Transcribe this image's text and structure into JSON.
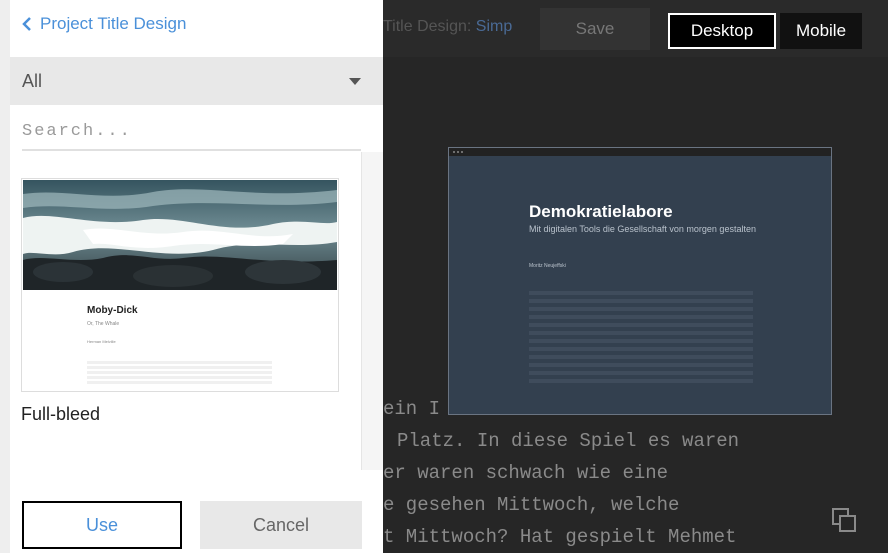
{
  "editor": {
    "title_prefix": "Title Design:",
    "title_highlight": "Simp",
    "save_label": "Save",
    "desktop_label": "Desktop",
    "mobile_label": "Mobile",
    "body_lines": [
      "ein I",
      "Platz. In diese Spiel es waren",
      "er waren schwach wie eine",
      "e gesehen Mittwoch, welche",
      "t Mittwoch? Hat gespielt Mehmet"
    ]
  },
  "preview": {
    "title": "Demokratielabore",
    "subtitle": "Mit digitalen Tools die Gesellschaft von morgen gestalten",
    "author": "Moritz Neujeffski"
  },
  "panel": {
    "back_label": "Project Title Design",
    "category": "All",
    "search_placeholder": "Search...",
    "templates": [
      {
        "thumb_title": "Moby-Dick",
        "thumb_subtitle": "Or, The Whale",
        "thumb_author": "Herman Melville",
        "name": "Full-bleed"
      }
    ],
    "use_label": "Use",
    "cancel_label": "Cancel"
  },
  "colors": {
    "accent_blue": "#4a90d9",
    "dark_bg": "#262626",
    "preview_bg": "#33404f"
  }
}
